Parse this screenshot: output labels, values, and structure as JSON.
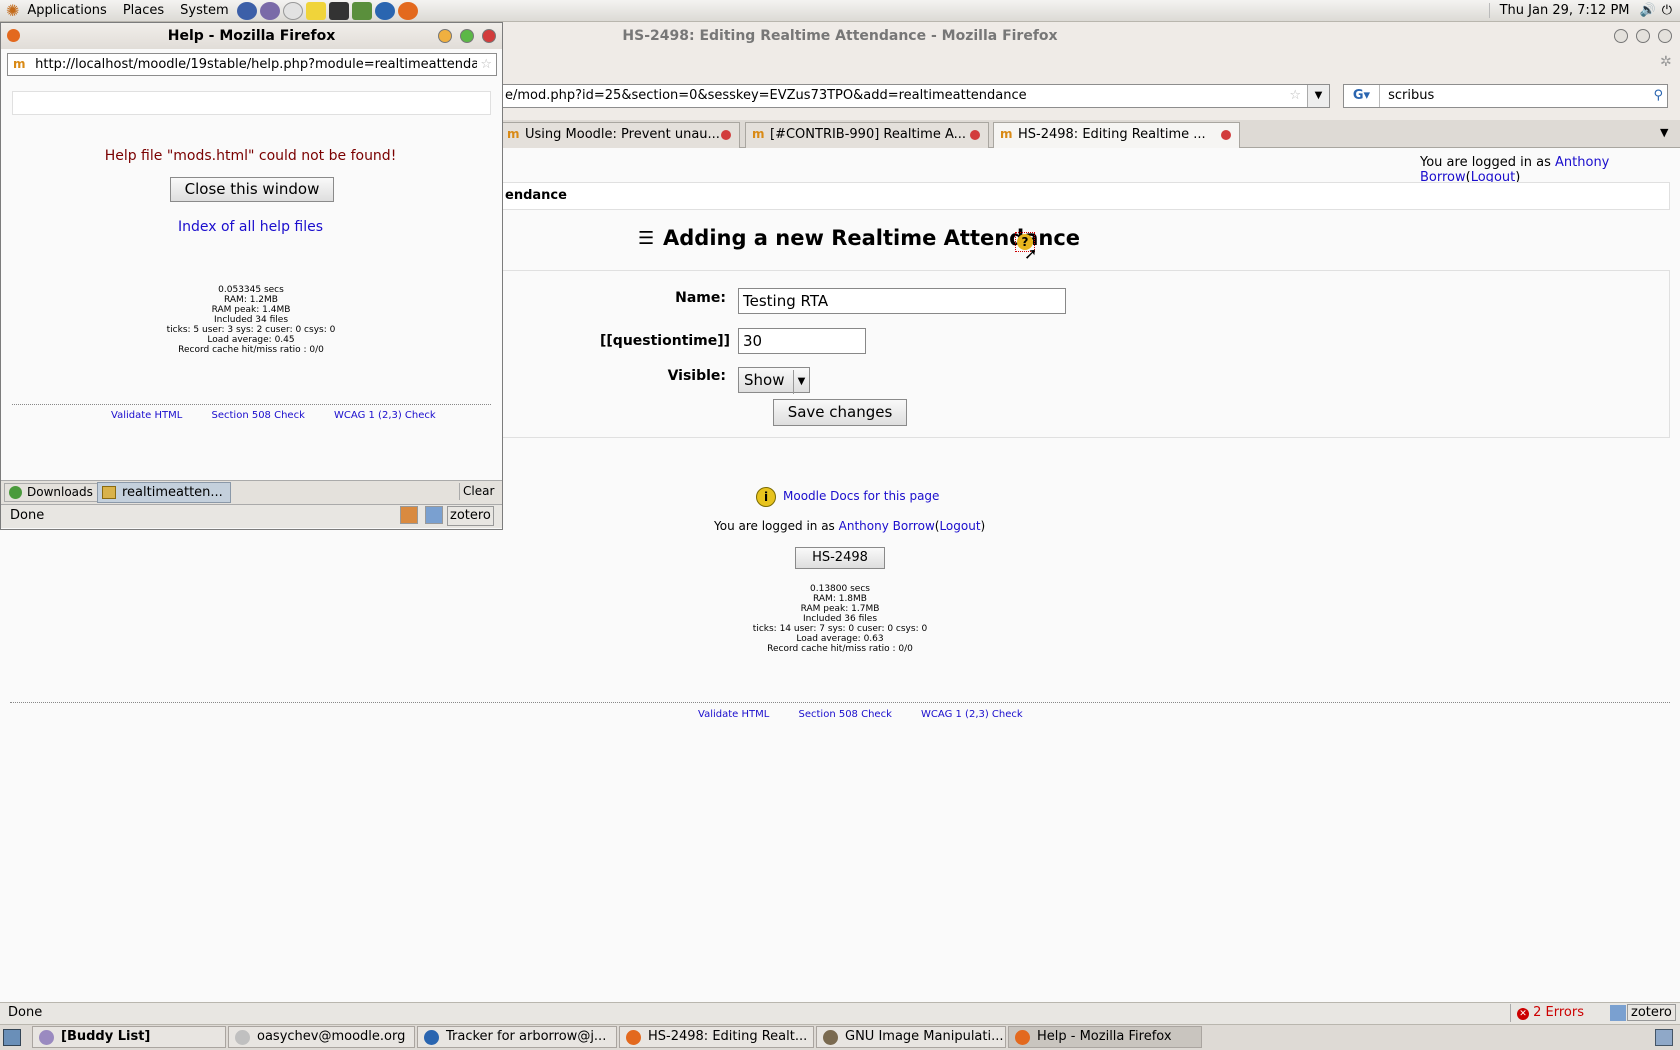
{
  "top_panel": {
    "menus": [
      "Applications",
      "Places",
      "System"
    ],
    "clock": "Thu Jan 29,  7:12 PM"
  },
  "main_window": {
    "title": "HS-2498: Editing Realtime Attendance - Mozilla Firefox",
    "url": "e/mod.php?id=25&section=0&sesskey=EVZus73TPO&add=realtimeattendance",
    "search_value": "scribus",
    "tabs": [
      "Using Moodle: Prevent unau...",
      "[#CONTRIB-990] Realtime A...",
      "HS-2498: Editing Realtime ..."
    ],
    "logged_in_prefix": "You are logged in as",
    "user_name": "Anthony Borrow",
    "logout": "Logout",
    "breadcrumb": "endance",
    "page_title": "Adding a new Realtime Attendance",
    "form": {
      "name_label": "Name:",
      "name_value": "Testing RTA",
      "qtime_label": "[[questiontime]]",
      "qtime_value": "30",
      "visible_label": "Visible:",
      "visible_value": "Show",
      "save_label": "Save changes"
    },
    "docs_link": "Moodle Docs for this page",
    "course_button": "HS-2498",
    "perf": [
      "0.13800 secs",
      "RAM: 1.8MB",
      "RAM peak: 1.7MB",
      "Included 36 files",
      "ticks: 14 user: 7 sys: 0 cuser: 0 csys: 0",
      "Load average: 0.63",
      "Record cache hit/miss ratio : 0/0"
    ],
    "footer_links": [
      "Validate HTML",
      "Section 508 Check",
      "WCAG 1 (2,3) Check"
    ],
    "status": "Done",
    "errors": "2 Errors",
    "zotero": "zotero"
  },
  "help_window": {
    "title": "Help - Mozilla Firefox",
    "url": "http://localhost/moodle/19stable/help.php?module=realtimeattendan",
    "error_msg": "Help file \"mods.html\" could not be found!",
    "close_button": "Close this window",
    "index_link": "Index of all help files",
    "perf": [
      "0.053345 secs",
      "RAM: 1.2MB",
      "RAM peak: 1.4MB",
      "Included 34 files",
      "ticks: 5 user: 3 sys: 2 cuser: 0 csys: 0",
      "Load average: 0.45",
      "Record cache hit/miss ratio : 0/0"
    ],
    "footer_links": [
      "Validate HTML",
      "Section 508 Check",
      "WCAG 1 (2,3) Check"
    ],
    "downloads_label": "Downloads",
    "download_item": "realtimeatten...",
    "clear_label": "Clear",
    "status": "Done",
    "zotero": "zotero"
  },
  "taskbar": [
    "[Buddy List]",
    "oasychev@moodle.org",
    "Tracker for arborrow@j...",
    "HS-2498: Editing Realt...",
    "GNU Image Manipulati...",
    "Help - Mozilla Firefox"
  ]
}
